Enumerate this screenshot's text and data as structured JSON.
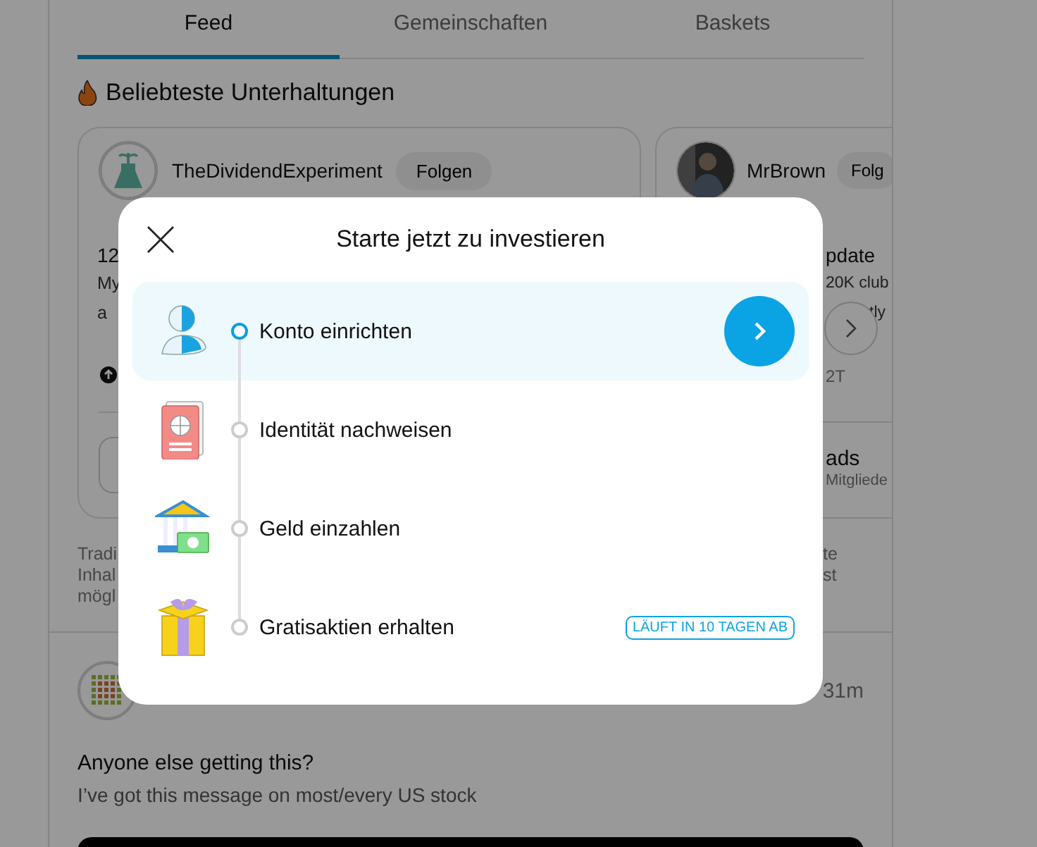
{
  "tabs": [
    {
      "label": "Feed",
      "selected": true
    },
    {
      "label": "Gemeinschaften",
      "selected": false
    },
    {
      "label": "Baskets",
      "selected": false
    }
  ],
  "section_title": "Beliebteste Unterhaltungen",
  "cards": [
    {
      "author": "TheDividendExperiment",
      "follow": "Folgen",
      "title": "12",
      "body": [
        "My",
        "a"
      ]
    },
    {
      "author": "MrBrown",
      "follow": "Folg",
      "title": "pdate",
      "body": [
        "20K club",
        "tly"
      ],
      "time": "2T",
      "community": "ads",
      "members": "Mitgliede"
    }
  ],
  "disclaimer": {
    "left": [
      "Tradi",
      "Inhal",
      "mögl"
    ],
    "right": [
      "te",
      "st"
    ]
  },
  "post": {
    "time": "31m",
    "title": "Anyone else getting this?",
    "body": "I’ve got this message on most/every US stock"
  },
  "modal": {
    "title": "Starte jetzt zu investieren",
    "steps": [
      {
        "label": "Konto einrichten",
        "selected": true
      },
      {
        "label": "Identität nachweisen",
        "selected": false
      },
      {
        "label": "Geld einzahlen",
        "selected": false
      },
      {
        "label": "Gratisaktien erhalten",
        "selected": false,
        "badge": "LÄUFT IN 10 TAGEN AB"
      }
    ]
  }
}
